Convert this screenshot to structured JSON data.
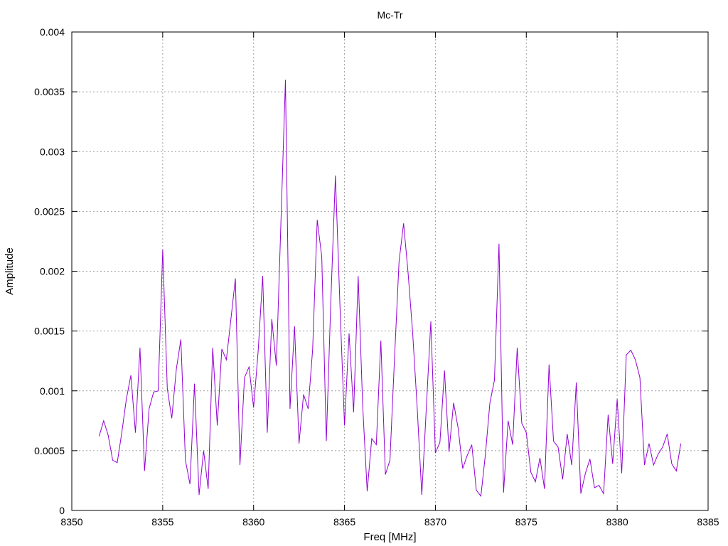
{
  "chart_data": {
    "type": "line",
    "title": "Mc-Tr",
    "xlabel": "Freq [MHz]",
    "ylabel": "Amplitude",
    "xlim": [
      8350,
      8385
    ],
    "ylim": [
      0,
      0.004
    ],
    "grid": true,
    "xticks": [
      8350,
      8355,
      8360,
      8365,
      8370,
      8375,
      8380,
      8385
    ],
    "xtick_labels": [
      "8350",
      "8355",
      "8360",
      "8365",
      "8370",
      "8375",
      "8380",
      "8385"
    ],
    "yticks": [
      0,
      0.0005,
      0.001,
      0.0015,
      0.002,
      0.0025,
      0.003,
      0.0035,
      0.004
    ],
    "ytick_labels": [
      "0",
      "0.0005",
      "0.001",
      "0.0015",
      "0.002",
      "0.0025",
      "0.003",
      "0.0035",
      "0.004"
    ],
    "series": [
      {
        "color": "#9400d3",
        "x": [
          8351.5,
          8351.75,
          8352.0,
          8352.25,
          8352.5,
          8352.75,
          8353.0,
          8353.25,
          8353.5,
          8353.75,
          8354.0,
          8354.25,
          8354.5,
          8354.75,
          8355.0,
          8355.25,
          8355.5,
          8355.75,
          8356.0,
          8356.25,
          8356.5,
          8356.75,
          8357.0,
          8357.25,
          8357.5,
          8357.75,
          8358.0,
          8358.25,
          8358.5,
          8358.75,
          8359.0,
          8359.25,
          8359.5,
          8359.75,
          8360.0,
          8360.25,
          8360.5,
          8360.75,
          8361.0,
          8361.25,
          8361.5,
          8361.75,
          8362.0,
          8362.25,
          8362.5,
          8362.75,
          8363.0,
          8363.25,
          8363.5,
          8363.75,
          8364.0,
          8364.25,
          8364.5,
          8364.75,
          8365.0,
          8365.25,
          8365.5,
          8365.75,
          8366.0,
          8366.25,
          8366.5,
          8366.75,
          8367.0,
          8367.25,
          8367.5,
          8367.75,
          8368.0,
          8368.25,
          8368.5,
          8368.75,
          8369.0,
          8369.25,
          8369.5,
          8369.75,
          8370.0,
          8370.25,
          8370.5,
          8370.75,
          8371.0,
          8371.25,
          8371.5,
          8371.75,
          8372.0,
          8372.25,
          8372.5,
          8372.75,
          8373.0,
          8373.25,
          8373.5,
          8373.75,
          8374.0,
          8374.25,
          8374.5,
          8374.75,
          8375.0,
          8375.25,
          8375.5,
          8375.75,
          8376.0,
          8376.25,
          8376.5,
          8376.75,
          8377.0,
          8377.25,
          8377.5,
          8377.75,
          8378.0,
          8378.25,
          8378.5,
          8378.75,
          8379.0,
          8379.25,
          8379.5,
          8379.75,
          8380.0,
          8380.25,
          8380.5,
          8380.75,
          8381.0,
          8381.25,
          8381.5,
          8381.75,
          8382.0,
          8382.25,
          8382.5,
          8382.75,
          8383.0,
          8383.25,
          8383.5
        ],
        "y": [
          0.00062,
          0.00075,
          0.00063,
          0.00042,
          0.0004,
          0.00065,
          0.00093,
          0.00113,
          0.00065,
          0.00136,
          0.00033,
          0.00085,
          0.00099,
          0.001,
          0.00218,
          0.00102,
          0.00077,
          0.00118,
          0.00143,
          0.00042,
          0.00022,
          0.00106,
          0.00013,
          0.0005,
          0.00018,
          0.00136,
          0.00071,
          0.00135,
          0.00126,
          0.0016,
          0.00194,
          0.00038,
          0.00111,
          0.0012,
          0.00086,
          0.00133,
          0.00196,
          0.00065,
          0.0016,
          0.00121,
          0.0024,
          0.0036,
          0.00085,
          0.00154,
          0.00056,
          0.00097,
          0.00085,
          0.00135,
          0.00243,
          0.00212,
          0.00058,
          0.00176,
          0.0028,
          0.00171,
          0.00071,
          0.00148,
          0.00082,
          0.00196,
          0.00088,
          0.00016,
          0.0006,
          0.00055,
          0.00142,
          0.0003,
          0.00042,
          0.00127,
          0.00208,
          0.0024,
          0.00198,
          0.00148,
          0.00085,
          0.00013,
          0.00085,
          0.00158,
          0.00048,
          0.00057,
          0.00117,
          0.00049,
          0.0009,
          0.00069,
          0.00035,
          0.00046,
          0.00055,
          0.00017,
          0.00012,
          0.00047,
          0.0009,
          0.00109,
          0.00223,
          0.00015,
          0.00075,
          0.00055,
          0.00136,
          0.00073,
          0.00065,
          0.00032,
          0.00024,
          0.00044,
          0.00018,
          0.00122,
          0.00058,
          0.00053,
          0.00026,
          0.00064,
          0.00038,
          0.00107,
          0.00014,
          0.00031,
          0.00043,
          0.00019,
          0.00021,
          0.00014,
          0.0008,
          0.00039,
          0.00093,
          0.00031,
          0.0013,
          0.00134,
          0.00126,
          0.00111,
          0.00038,
          0.00056,
          0.00038,
          0.00047,
          0.00053,
          0.00064,
          0.00039,
          0.00033,
          0.00056
        ]
      }
    ]
  }
}
